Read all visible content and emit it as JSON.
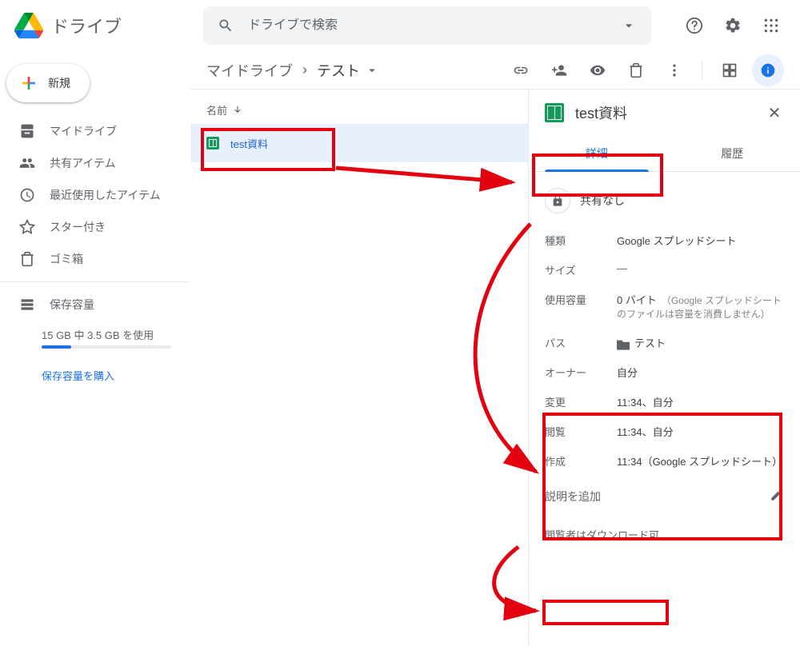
{
  "header": {
    "title": "ドライブ",
    "search_placeholder": "ドライブで検索"
  },
  "sidebar": {
    "new_label": "新規",
    "items": [
      {
        "label": "マイドライブ"
      },
      {
        "label": "共有アイテム"
      },
      {
        "label": "最近使用したアイテム"
      },
      {
        "label": "スター付き"
      },
      {
        "label": "ゴミ箱"
      }
    ],
    "storage_label": "保存容量",
    "storage_usage": "15 GB 中 3.5 GB を使用",
    "buy_storage": "保存容量を購入"
  },
  "breadcrumb": {
    "root": "マイドライブ",
    "current": "テスト"
  },
  "list": {
    "col_name": "名前",
    "file_name": "test資料"
  },
  "details": {
    "title": "test資料",
    "tab_details": "詳細",
    "tab_history": "履歴",
    "share_status": "共有なし",
    "props": {
      "type_label": "種類",
      "type_value": "Google スプレッドシート",
      "size_label": "サイズ",
      "size_value": "—",
      "used_label": "使用容量",
      "used_value": "0 バイト",
      "used_note": "（Google スプレッドシートのファイルは容量を消費しません）",
      "path_label": "パス",
      "path_value": "テスト",
      "owner_label": "オーナー",
      "owner_value": "自分",
      "modified_label": "変更",
      "modified_value": "11:34、自分",
      "viewed_label": "閲覧",
      "viewed_value": "11:34、自分",
      "created_label": "作成",
      "created_value": "11:34（Google スプレッドシート）"
    },
    "add_description": "説明を追加",
    "viewer_download": "閲覧者はダウンロード可"
  }
}
